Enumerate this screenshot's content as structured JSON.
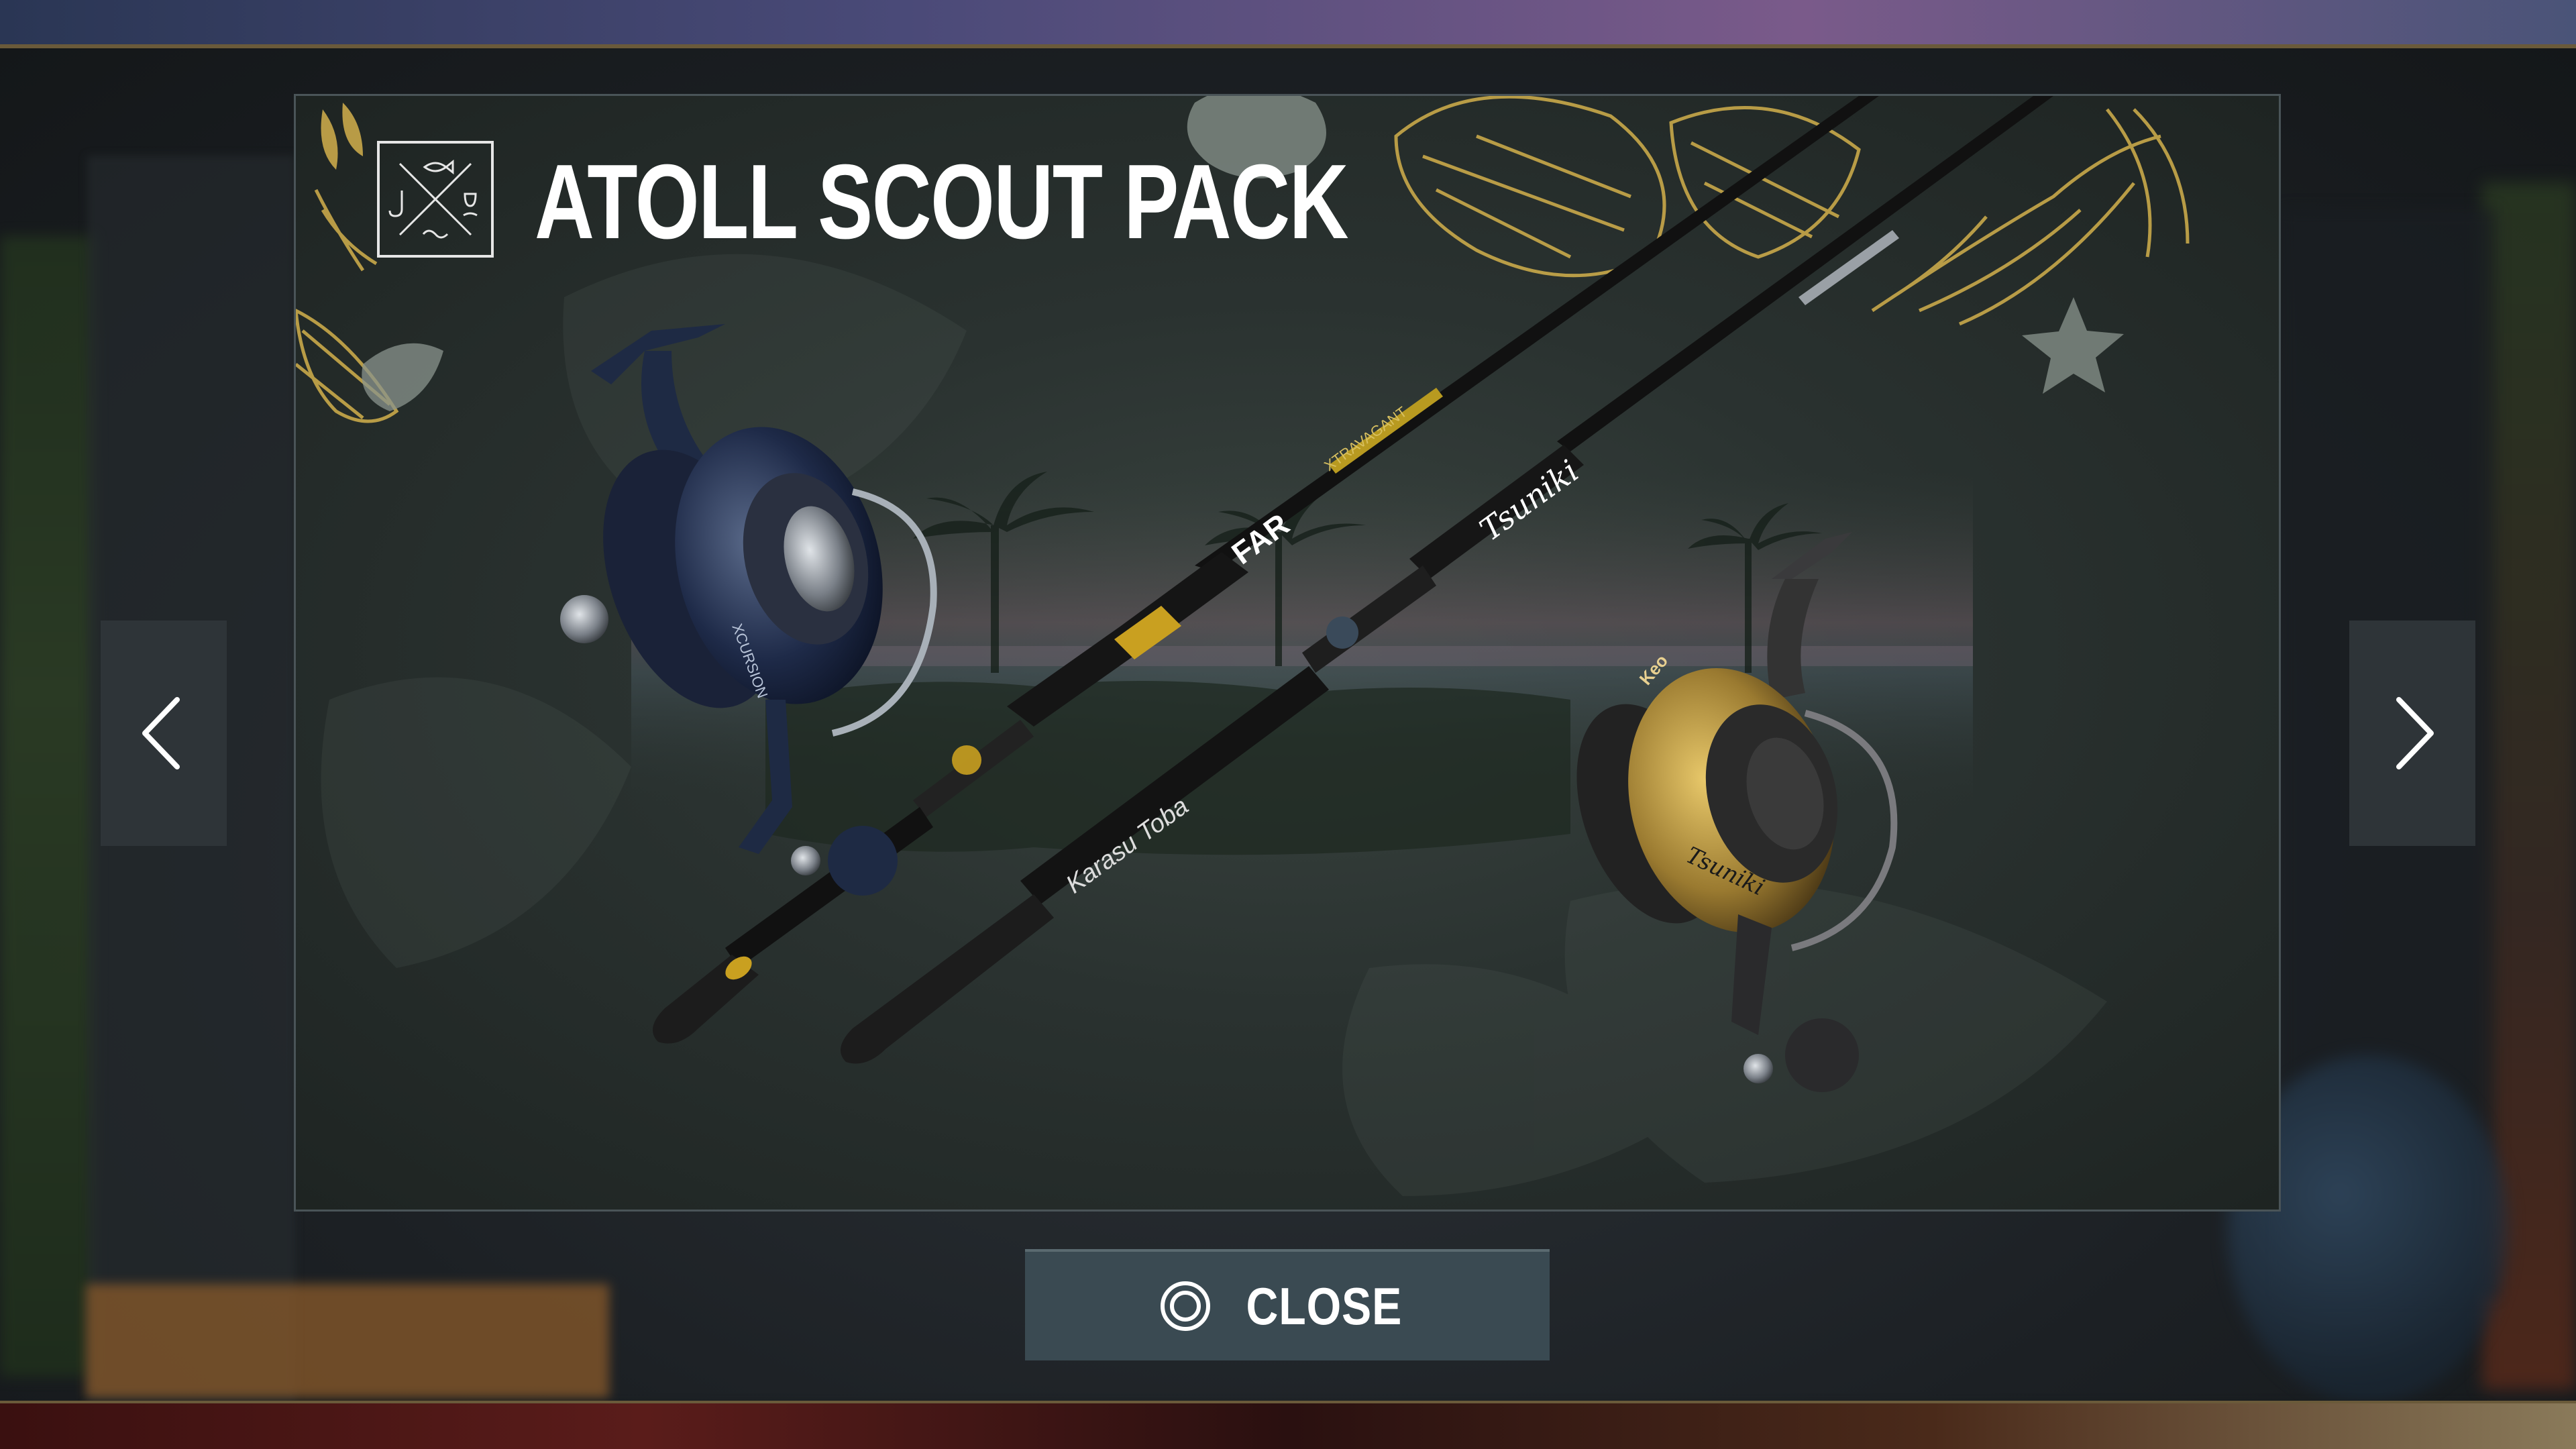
{
  "dialog": {
    "title": "ATOLL SCOUT PACK"
  },
  "products": {
    "rod_1_brand": "FAR",
    "rod_1_model": "XTRAVAGANT",
    "rod_2_brand": "Tsuniki",
    "rod_2_model": "Karasu Toba",
    "reel_1_brand": "XCURSION",
    "reel_2_brand": "Tsuniki",
    "reel_2_label": "Keo"
  },
  "buttons": {
    "close_label": "CLOSE",
    "close_icon": "circle-button-icon",
    "prev_icon": "chevron-left-icon",
    "next_icon": "chevron-right-icon"
  },
  "colors": {
    "accent_gold": "#c9a94a",
    "button_bg": "#3a4a52",
    "nav_bg": "#2e3438",
    "title_text": "#ffffff"
  }
}
